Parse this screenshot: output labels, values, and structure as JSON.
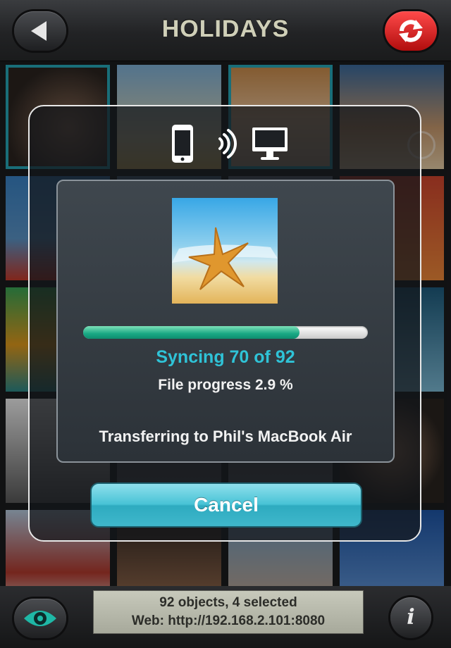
{
  "header": {
    "title": "HOLIDAYS",
    "back_icon": "back-arrow-icon",
    "refresh_icon": "sync-refresh-icon"
  },
  "grid": {
    "selected_color": "#27a9bb",
    "tiles": [
      {
        "name": "photo-woman-hat",
        "selected": true,
        "checked": false
      },
      {
        "name": "photo-child-beach",
        "selected": false,
        "checked": false
      },
      {
        "name": "photo-dog-sunglasses",
        "selected": true,
        "checked": false
      },
      {
        "name": "photo-boy-smiling",
        "selected": false,
        "checked": true
      },
      {
        "name": "photo-girl-red",
        "selected": false,
        "checked": false
      },
      {
        "name": "photo-grid-6",
        "selected": false,
        "checked": true
      },
      {
        "name": "photo-grid-7",
        "selected": false,
        "checked": true
      },
      {
        "name": "photo-grid-8",
        "selected": false,
        "checked": false
      }
    ]
  },
  "sync_dialog": {
    "source_icon": "iphone-icon",
    "signal_icon": "wireless-signal-icon",
    "target_icon": "desktop-monitor-icon",
    "thumbnail": "starfish-photo",
    "progress": 0.76,
    "progress_color": "#19a884",
    "status": "Syncing 70 of 92",
    "file_progress": "File progress 2.9 %",
    "transfer": "Transferring to Phil's MacBook Air",
    "cancel_label": "Cancel"
  },
  "bottom_bar": {
    "eye_icon": "eye-icon",
    "status_line1": "92 objects, 4 selected",
    "status_line2": "Web: http://192.168.2.101:8080",
    "info_label": "i"
  }
}
